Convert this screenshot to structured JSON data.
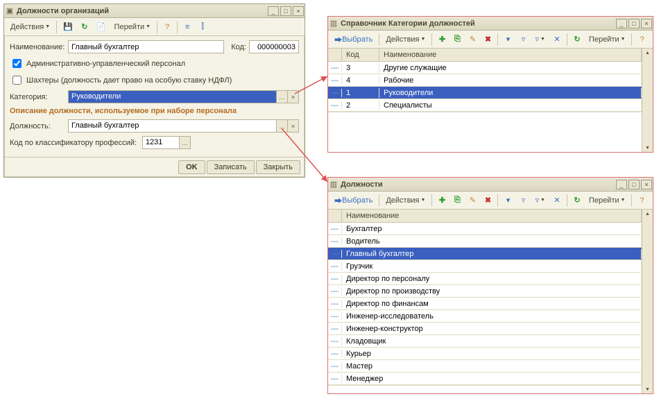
{
  "win1": {
    "title": "Должности организаций",
    "toolbar": {
      "actions": "Действия",
      "goto": "Перейти"
    },
    "labels": {
      "name": "Наименование:",
      "code": "Код:",
      "admin": "Административно-управленческий персонал",
      "miners": "Шахтеры (должность дает право на особую ставку НДФЛ)",
      "category": "Категория:",
      "section": "Описание должности, используемое при наборе персонала",
      "position": "Должность:",
      "classifier": "Код по классификатору профессий:"
    },
    "values": {
      "name": "Главный бухгалтер",
      "code": "000000003",
      "admin_checked": true,
      "miners_checked": false,
      "category": "Руководители",
      "position": "Главный бухгалтер",
      "classifier": "1231"
    },
    "buttons": {
      "ok": "OK",
      "write": "Записать",
      "close": "Закрыть"
    }
  },
  "win2": {
    "title": "Справочник Категории должностей",
    "toolbar": {
      "select": "Выбрать",
      "actions": "Действия",
      "goto": "Перейти"
    },
    "columns": {
      "code": "Код",
      "name": "Наименование"
    },
    "rows": [
      {
        "code": "3",
        "name": "Другие служащие",
        "selected": false
      },
      {
        "code": "4",
        "name": "Рабочие",
        "selected": false
      },
      {
        "code": "1",
        "name": "Руководители",
        "selected": true
      },
      {
        "code": "2",
        "name": "Специалисты",
        "selected": false
      }
    ]
  },
  "win3": {
    "title": "Должности",
    "toolbar": {
      "select": "Выбрать",
      "actions": "Действия",
      "goto": "Перейти"
    },
    "columns": {
      "name": "Наименование"
    },
    "rows": [
      {
        "name": "Бухгалтер",
        "selected": false
      },
      {
        "name": "Водитель",
        "selected": false
      },
      {
        "name": "Главный бухгалтер",
        "selected": true
      },
      {
        "name": "Грузчик",
        "selected": false
      },
      {
        "name": "Директор по персоналу",
        "selected": false
      },
      {
        "name": "Директор по производству",
        "selected": false
      },
      {
        "name": "Директор по финансам",
        "selected": false
      },
      {
        "name": "Инженер-исследователь",
        "selected": false
      },
      {
        "name": "Инженер-конструктор",
        "selected": false
      },
      {
        "name": "Кладовщик",
        "selected": false
      },
      {
        "name": "Курьер",
        "selected": false
      },
      {
        "name": "Мастер",
        "selected": false
      },
      {
        "name": "Менеджер",
        "selected": false
      }
    ]
  }
}
